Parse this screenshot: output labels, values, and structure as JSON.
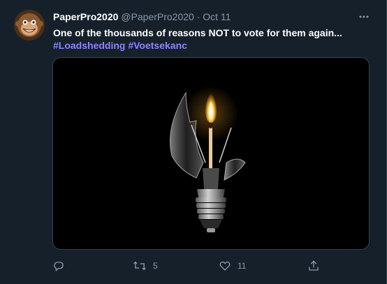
{
  "author": {
    "name": "PaperPro2020",
    "handle": "@PaperPro2020",
    "separator": "·",
    "date": "Oct 11"
  },
  "tweet": {
    "text": "One of the thousands of reasons NOT to vote for them again...",
    "hashtags": [
      "#Loadshedding",
      "#Voetsekanc"
    ]
  },
  "actions": {
    "reply_count": "",
    "retweet_count": "5",
    "like_count": "11"
  },
  "icons": [
    "avatar-icon",
    "more-icon",
    "reply-icon",
    "retweet-icon",
    "like-icon",
    "share-icon"
  ],
  "colors": {
    "background": "#15202b",
    "hashtag": "#8f82ff",
    "secondary_text": "#8b98a5",
    "border": "#38444d",
    "flame": "#ffb02e"
  }
}
